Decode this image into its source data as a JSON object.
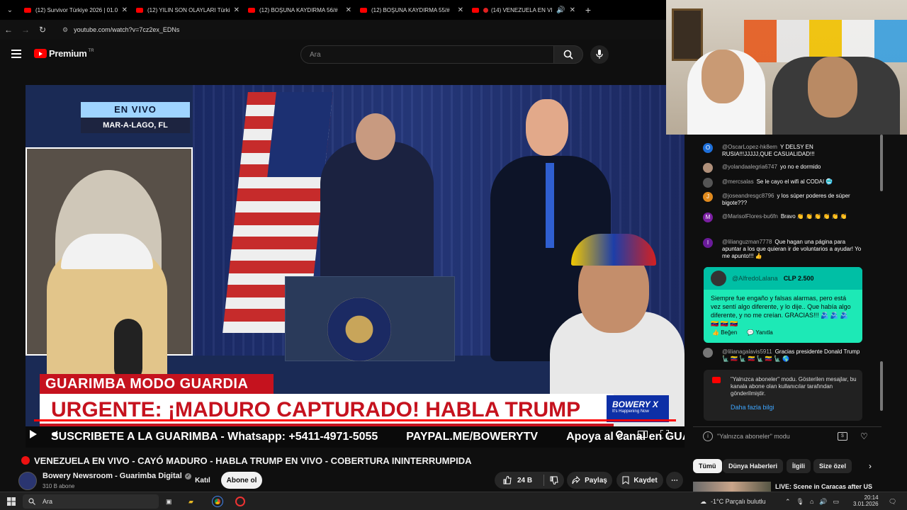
{
  "browser": {
    "tabs": [
      {
        "title": "(12) Survivor Türkiye 2026 | 01.0"
      },
      {
        "title": "(12) YILIN SON OLAYLARI Türkiye"
      },
      {
        "title": "(12) BOŞUNA KAYDIRMA 56/#"
      },
      {
        "title": "(12) BOŞUNA KAYDIRMA 55/#"
      },
      {
        "title": "(14) VENEZUELA EN VIVO"
      }
    ],
    "url": "youtube.com/watch?v=7cz2ex_EDNs"
  },
  "youtube": {
    "logo_text": "Premium",
    "logo_badge": "TR",
    "search_placeholder": "Ara"
  },
  "video": {
    "live_label": "EN VIVO",
    "location": "MAR-A-LAGO, FL",
    "lower_third_top": "GUARIMBA MODO GUARDIA",
    "headline": "URGENTE:  ¡MADURO CAPTURADO!  HABLA TRUMP",
    "brand": "BOWERY X",
    "brand_sub": "It's Happening Now",
    "ticker": [
      "SUSCRIBETE A LA GUARIMBA - Whatsapp: +5411-4971-5055",
      "PAYPAL.ME/BOWERYTV",
      "Apoya al canal en GUARIMBADIGITAL.COM"
    ],
    "progress_fraction": 1.0,
    "title": "VENEZUELA EN VIVO - CAYÓ MADURO - HABLA TRUMP EN VIVO - COBERTURA ININTERRUMPIDA"
  },
  "channel": {
    "name": "Bowery Newsroom - Guarimba Digital",
    "subscribers": "310 B abone",
    "join_label": "Katıl",
    "subscribe_label": "Abone ol"
  },
  "actions": {
    "likes": "24 B",
    "share": "Paylaş",
    "save": "Kaydet"
  },
  "chat": {
    "messages": [
      {
        "user": "@OscarLopez-hk8em",
        "text": "Y DELSY EN RUSIA!!!JJJJJ,QUE CASUALIDAD!!!",
        "avatar": "O",
        "color": "#1e6fd9"
      },
      {
        "user": "@yolandaalegria6747",
        "text": "yo no e dormido",
        "avatar": "",
        "color": "#b0907a"
      },
      {
        "user": "@mercsalas",
        "text": "Se le cayo el wifi al CODAI 🥶",
        "avatar": "",
        "color": "#555"
      },
      {
        "user": "@joseandresgc8796",
        "text": "y los súper poderes de súper bigote???",
        "avatar": "J",
        "color": "#e08a1e"
      },
      {
        "user": "@MarisolFlores-bu6fn",
        "text": "Bravo 👏 👏 👏 👏 👏 👏",
        "avatar": "M",
        "color": "#7b1fa2"
      },
      {
        "user": "@lilianguzman7778",
        "text": "Que hagan una página para apuntar a los que quieran ir de voluntarios a ayudar! Yo me apunto!!! 👍",
        "avatar": "l",
        "color": "#6a1b9a"
      },
      {
        "user": "@lilianagalavis5911",
        "text": "Gracias presidente Donald Trump 🗽 🇻🇪 🗽 🇻🇪 🗽 🇻🇪 🗽 🌎",
        "avatar": "",
        "color": "#777"
      }
    ],
    "superchat": {
      "user": "@AlfredoLalana",
      "amount": "CLP 2.500",
      "text": "Siempre fue engaño y falsas alarmas, pero está vez sentí algo diferente, y lo dije.. Que había algo diferente, y no me creían. GRACIAS!!! 🫂 🫂 🫂 🇻🇪 🇻🇪 🇻🇪",
      "like": "Beğen",
      "reply": "Yanıtla"
    },
    "notice": {
      "text": "\"Yalnızca aboneler\" modu. Gösterilen mesajlar, bu kanala abone olan kullanıcılar tarafından gönderilmiştir.",
      "more": "Daha fazla bilgi"
    },
    "footer": "\"Yalnızca aboneler\" modu"
  },
  "chips": [
    "Tümü",
    "Dünya Haberleri",
    "İlgili",
    "Size özel"
  ],
  "related": {
    "title": "LIVE: Scene in Caracas after US"
  },
  "taskbar": {
    "search": "Ara",
    "weather": "-1°C  Parçalı bulutlu",
    "time": "20:14",
    "date": "3.01.2026"
  }
}
